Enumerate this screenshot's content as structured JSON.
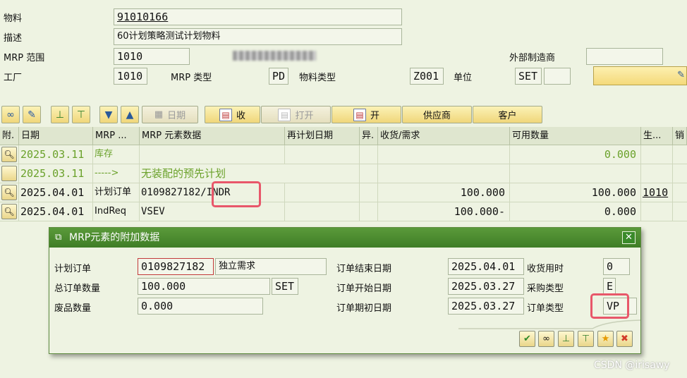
{
  "header": {
    "material_label": "物料",
    "material_value": "91010166",
    "desc_label": "描述",
    "desc_value": "60计划策略测试计划物料",
    "mrp_area_label": "MRP 范围",
    "mrp_area_value": "1010",
    "ext_vendor_label": "外部制造商",
    "plant_label": "工厂",
    "plant_value": "1010",
    "mrp_type_label": "MRP 类型",
    "mrp_type_value": "PD",
    "mat_type_label": "物料类型",
    "mat_type_value": "Z001",
    "unit_label": "单位",
    "unit_value": "SET"
  },
  "toolbar": {
    "date_label": "日期",
    "receipt_label": "收",
    "open_label": "打开",
    "open2_label": "开",
    "supplier_label": "供应商",
    "customer_label": "客户",
    "receipt_icon": "receipts-icon",
    "open_icon": "open-folder-icon",
    "open2_icon": "requirements-icon"
  },
  "table": {
    "columns": [
      "附.",
      "日期",
      "MRP ...",
      "MRP 元素数据",
      "再计划日期",
      "异.",
      "收货/需求",
      "可用数量",
      "生...",
      "销"
    ],
    "rows": [
      {
        "date": "2025.03.11",
        "element": "库存",
        "data": "",
        "qty": "",
        "avail": "0.000",
        "plant": "",
        "style": "green"
      },
      {
        "date": "2025.03.11",
        "element": "----->",
        "data": "无装配的预先计划",
        "qty": "",
        "avail": "",
        "plant": "",
        "style": "green"
      },
      {
        "date": "2025.04.01",
        "element": "计划订单",
        "data": "0109827182/INDR",
        "qty": "100.000",
        "avail": "100.000",
        "plant": "1010",
        "style": "normal"
      },
      {
        "date": "2025.04.01",
        "element": "IndReq",
        "data": "VSEV",
        "qty": "100.000-",
        "avail": "0.000",
        "plant": "",
        "style": "normal"
      }
    ]
  },
  "dialog": {
    "title": "MRP元素的附加数据",
    "planned_order_label": "计划订单",
    "planned_order_value": "0109827182",
    "planned_order_desc": "独立需求",
    "total_qty_label": "总订单数量",
    "total_qty_value": "100.000",
    "total_qty_unit": "SET",
    "scrap_label": "废品数量",
    "scrap_value": "0.000",
    "end_date_label": "订单结束日期",
    "end_date_value": "2025.04.01",
    "start_date_label": "订单开始日期",
    "start_date_value": "2025.03.27",
    "opening_date_label": "订单期初日期",
    "opening_date_value": "2025.03.27",
    "gr_time_label": "收货用时",
    "gr_time_value": "0",
    "proc_type_label": "采购类型",
    "proc_type_value": "E",
    "order_type_label": "订单类型",
    "order_type_value": "VP"
  },
  "watermark": "CSDN @irisawy"
}
